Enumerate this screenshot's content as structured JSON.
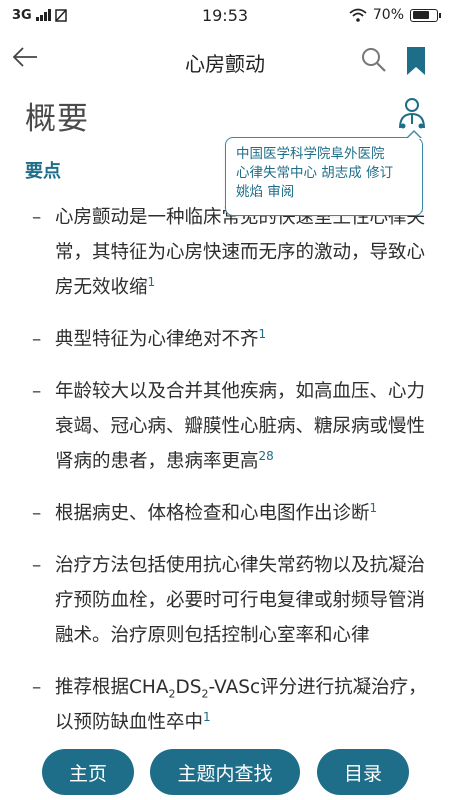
{
  "status_bar": {
    "network": "3G",
    "time": "19:53",
    "battery_text": "70%",
    "battery_level": 0.7
  },
  "nav": {
    "title": "心房颤动"
  },
  "page": {
    "heading": "概要",
    "subheading": "要点"
  },
  "author_popup": {
    "line1": "中国医学科学院阜外医院",
    "line2": "心律失常中心 胡志成 修订",
    "line3": "姚焰 审阅"
  },
  "bullets": [
    {
      "text": "心房颤动是一种临床常见的快速室上性心律失常，其特征为心房快速而无序的激动，导致心房无效收缩",
      "ref": "1"
    },
    {
      "text": "典型特征为心律绝对不齐",
      "ref": "1"
    },
    {
      "text": "年龄较大以及合并其他疾病，如高血压、心力衰竭、冠心病、瓣膜性心脏病、糖尿病或慢性肾病的患者，患病率更高",
      "ref": "28"
    },
    {
      "text": "根据病史、体格检查和心电图作出诊断",
      "ref": "1"
    },
    {
      "text": "治疗方法包括使用抗心律失常药物以及抗凝治疗预防血栓，必要时可行电复律或射频导管消融术。治疗原则包括控制心室率和心律",
      "ref": ""
    },
    {
      "pre": "推荐根据CHA",
      "sub1": "2",
      "mid": "DS",
      "sub2": "2",
      "post": "-VASc评分进行抗凝治疗，以预防缺血性卒中",
      "ref": "1"
    }
  ],
  "bottom_bar": {
    "home_label": "主页",
    "find_label": "主题内查找",
    "toc_label": "目录"
  },
  "colors": {
    "accent": "#1e6e89",
    "text": "#2e2e2e"
  },
  "icons": [
    "back-arrow-icon",
    "search-icon",
    "bookmark-icon",
    "author-icon",
    "wifi-icon",
    "signal-icon",
    "battery-icon"
  ]
}
